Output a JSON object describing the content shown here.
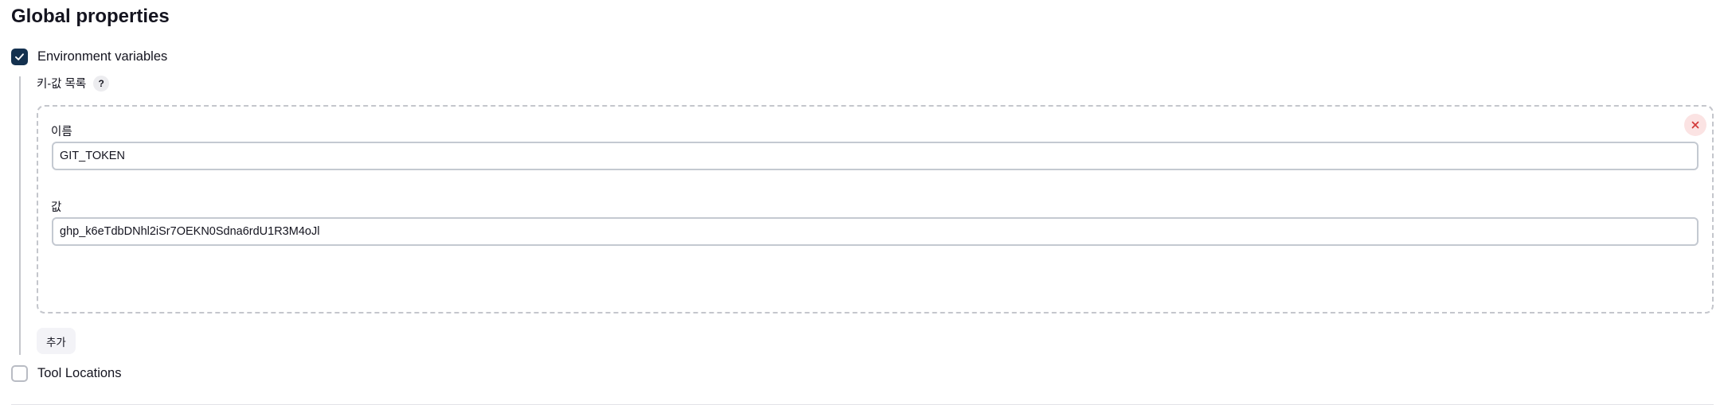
{
  "section": {
    "title": "Global properties"
  },
  "env_vars": {
    "checked": true,
    "label": "Environment variables",
    "kv_list_label": "키-값 목록",
    "help_symbol": "?",
    "entries": [
      {
        "name_label": "이름",
        "name_value": "GIT_TOKEN",
        "value_label": "값",
        "value_value": "ghp_k6eTdbDNhl2iSr7OEKN0Sdna6rdU1R3M4oJl"
      }
    ],
    "add_button": "추가"
  },
  "tool_locations": {
    "checked": false,
    "label": "Tool Locations"
  },
  "icons": {
    "checkbox_checked": "check-icon",
    "delete": "close-icon"
  },
  "colors": {
    "checkbox_checked_bg": "#14314f",
    "delete_icon": "#d23838",
    "delete_bg": "#fbe3e3"
  }
}
